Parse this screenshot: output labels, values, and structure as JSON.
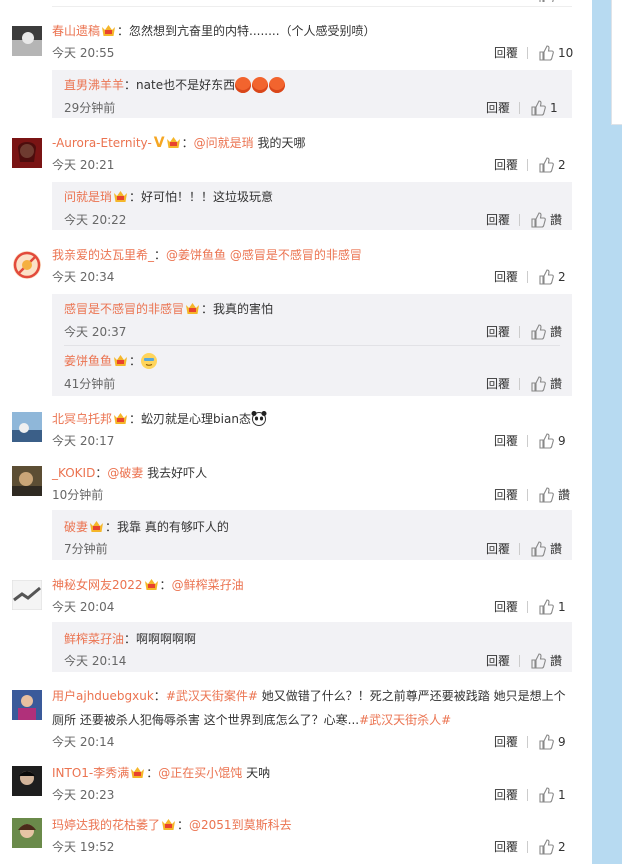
{
  "comments": [
    {
      "name": "春山遗稿",
      "sep": "：",
      "text": "忽然想到亢奋里的内特........（个人感受别喷）",
      "time": "今天 20:55",
      "reply": "回覆",
      "likes": "10",
      "avatar_color": "#3a3a3a",
      "replies": [
        {
          "name": "直男沸羊羊",
          "sep": "：",
          "text": "nate也不是好东西",
          "time": "29分钟前",
          "reply": "回覆",
          "likes": "1",
          "emoji_count": 3
        }
      ]
    },
    {
      "name": "-Aurora-Eternity-",
      "sep": "：",
      "at": "@问就是琑",
      "text": " 我的天哪",
      "time": "今天 20:21",
      "reply": "回覆",
      "likes": "2",
      "avatar_color": "#8b1a1a",
      "replies": [
        {
          "name": "问就是琑",
          "sep": "：",
          "text": "好可怕！！！这垃圾玩意",
          "time": "今天 20:22",
          "reply": "回覆",
          "likes": "讚"
        }
      ]
    },
    {
      "name": "我亲爱的达瓦里希_",
      "sep": "：",
      "at": "@姜饼鱼鱼",
      "at2": "@感冒是不感冒的非感冒",
      "time": "今天 20:34",
      "reply": "回覆",
      "likes": "2",
      "avatar_color": "#f0a030",
      "replies": [
        {
          "name": "感冒是不感冒的非感冒",
          "sep": "：",
          "text": "我真的害怕",
          "time": "今天 20:37",
          "reply": "回覆",
          "likes": "讚"
        },
        {
          "name": "姜饼鱼鱼",
          "sep": "：",
          "text": "",
          "time": "41分钟前",
          "reply": "回覆",
          "likes": "讚",
          "emoji": "cool"
        }
      ]
    },
    {
      "name": "北冥乌托邦",
      "sep": "：",
      "text": "蚣刃就是心理bian态",
      "time": "今天 20:17",
      "reply": "回覆",
      "likes": "9",
      "avatar_color": "#4a7aa8",
      "replies": []
    },
    {
      "name": "_KOKID",
      "sep": "：",
      "at": "@破妻",
      "text": " 我去好吓人",
      "time": "10分钟前",
      "reply": "回覆",
      "likes": "讚",
      "avatar_color": "#6b6040",
      "replies": [
        {
          "name": "破妻",
          "sep": "：",
          "text": "我靠 真的有够吓人的",
          "time": "7分钟前",
          "reply": "回覆",
          "likes": "讚"
        }
      ]
    },
    {
      "name": "神秘女网友2022",
      "sep": "：",
      "at": "@鲜榨菜孖油",
      "time": "今天 20:04",
      "reply": "回覆",
      "likes": "1",
      "avatar_color": "#e8e8e8",
      "replies": [
        {
          "name": "鲜榨菜孖油",
          "sep": "：",
          "text": "啊啊啊啊啊",
          "time": "今天 20:14",
          "reply": "回覆",
          "likes": "讚"
        }
      ]
    },
    {
      "name": "用户ajhduebgxuk",
      "sep": "：",
      "tag1": "#武汉天街案件#",
      "text": " 她又做错了什么？！死之前尊严还要被践踏 她只是想上个厕所 还要被杀人犯侮辱杀害 这个世界到底怎么了？心寒...",
      "tag2": "#武汉天街杀人#",
      "time": "今天 20:14",
      "reply": "回覆",
      "likes": "9",
      "avatar_color": "#9a4a8a",
      "replies": []
    },
    {
      "name": "INTO1-李秀满",
      "sep": "：",
      "at": "@正在买小馄饨",
      "text": " 天呐",
      "time": "今天 20:23",
      "reply": "回覆",
      "likes": "1",
      "avatar_color": "#2a2a2a",
      "replies": []
    },
    {
      "name": "玛婷达我的花枯萎了",
      "sep": "：",
      "at": "@2051到莫斯科去",
      "time": "今天 19:52",
      "reply": "回覆",
      "likes": "2",
      "avatar_color": "#5a7a3a",
      "replies": []
    }
  ]
}
